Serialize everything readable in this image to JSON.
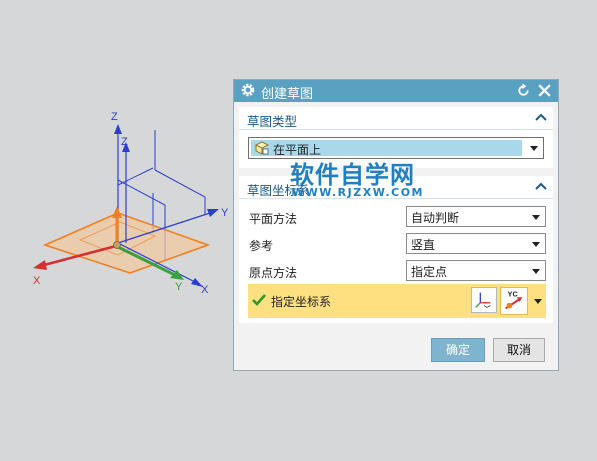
{
  "dialog": {
    "title": "创建草图",
    "section_type": {
      "header": "草图类型",
      "selected": "在平面上"
    },
    "section_csys": {
      "header": "草图坐标系",
      "rows": [
        {
          "label": "平面方法",
          "value": "自动判断"
        },
        {
          "label": "参考",
          "value": "竖直"
        },
        {
          "label": "原点方法",
          "value": "指定点"
        }
      ],
      "specify_label": "指定坐标系",
      "yc_icon_label": "YC"
    },
    "ok_label": "确定",
    "cancel_label": "取消"
  },
  "viewport": {
    "axes": {
      "z_label": "Z",
      "zc_label": "Z",
      "y_label": "Y",
      "x_label": "X",
      "yc_label": "Y",
      "xc_label": "X"
    }
  },
  "watermark": {
    "main": "软件自学网",
    "url": "WWW.RJZXW.COM"
  },
  "colors": {
    "titlebar": "#5aa0c0",
    "section_title": "#1a5a8a",
    "highlight_row": "#ffe080",
    "ok_button": "#7fb4cf",
    "plane_fill": "#f0c8a0",
    "plane_edge": "#f08020",
    "axis_blue": "#2a3fd0",
    "axis_red": "#d43030",
    "axis_green": "#3aa040"
  }
}
